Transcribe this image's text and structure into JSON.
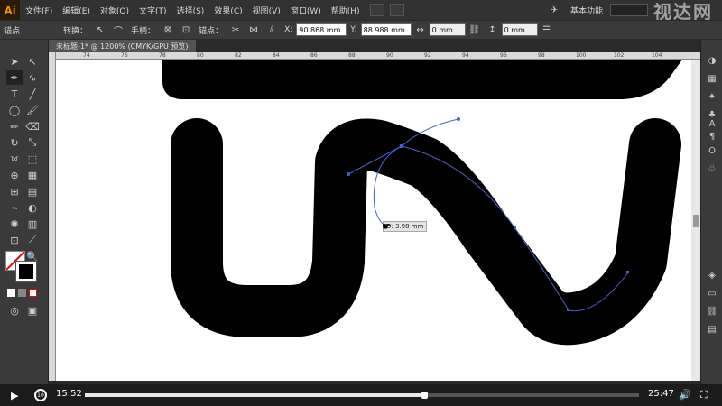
{
  "app": {
    "logo": "Ai"
  },
  "menu": [
    "文件(F)",
    "编辑(E)",
    "对象(O)",
    "文字(T)",
    "选择(S)",
    "效果(C)",
    "视图(V)",
    "窗口(W)",
    "帮助(H)"
  ],
  "workspace": {
    "label": "基本功能"
  },
  "watermark": "视达网",
  "control_bar": {
    "anchor_label": "锚点",
    "convert_label": "转换：",
    "handle_label": "手柄：",
    "anchor_label2": "锚点：",
    "x_value": "90.868 mm",
    "y_value": "88.988 mm",
    "w_value": "0 mm",
    "h_value": "0 mm"
  },
  "document_tab": {
    "title": "未标题-1* @ 1200% (CMYK/GPU 预览)"
  },
  "ruler": {
    "top_labels": [
      "74",
      "76",
      "78",
      "80",
      "82",
      "84",
      "86",
      "88",
      "90",
      "92",
      "94",
      "96",
      "98",
      "100",
      "102",
      "104"
    ]
  },
  "tooltip": {
    "text": "D: 3.98 mm"
  },
  "player": {
    "current_time": "15:52",
    "total_time": "25:47",
    "progress": 0.612
  },
  "colors": {
    "accent_logo": "#ff9a00",
    "path_blue": "#4a5fd0",
    "shape_fill": "#000000"
  },
  "icons": {
    "tools": [
      "selection",
      "direct-selection",
      "pen",
      "curvature",
      "type",
      "line",
      "rectangle",
      "paintbrush",
      "pencil",
      "eraser",
      "rotate",
      "scale",
      "width",
      "free-transform",
      "shape-builder",
      "perspective",
      "mesh",
      "gradient",
      "eyedropper",
      "blend",
      "symbol-sprayer",
      "column-graph",
      "artboard",
      "slice",
      "hand",
      "zoom"
    ],
    "right_panel": [
      "color",
      "swatches",
      "brushes",
      "symbols",
      "type",
      "paragraph",
      "opentype",
      "glyphs",
      "layers",
      "artboards",
      "links",
      "properties"
    ]
  }
}
